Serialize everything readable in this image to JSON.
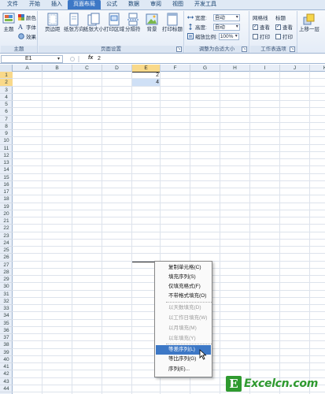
{
  "tabs": [
    "文件",
    "开始",
    "插入",
    "页面布局",
    "公式",
    "数据",
    "审阅",
    "视图",
    "开发工具"
  ],
  "active_tab": "页面布局",
  "ribbon": {
    "theme": {
      "big_label": "主题",
      "colors": "颜色",
      "fonts": "字体",
      "effects": "效果",
      "group": "主题"
    },
    "page_setup": {
      "margins": "页边距",
      "orientation": "纸张方向",
      "size": "纸张大小",
      "print_area": "打印区域",
      "breaks": "分隔符",
      "background": "背景",
      "print_titles": "打印标题",
      "group": "页面设置"
    },
    "scale": {
      "width_label": "宽度:",
      "width_value": "自动",
      "height_label": "高度:",
      "height_value": "自动",
      "scale_label": "缩放比例:",
      "scale_value": "100%",
      "group": "调整为合适大小"
    },
    "sheet_options": {
      "gridlines": "网格线",
      "headings": "标题",
      "view": "查看",
      "print": "打印",
      "group": "工作表选项"
    },
    "arrange": {
      "bring_forward": "上移一层"
    }
  },
  "formula_bar": {
    "name_box": "E1",
    "fx": "fx",
    "formula": "2"
  },
  "columns": [
    "A",
    "B",
    "C",
    "D",
    "E",
    "F",
    "G",
    "H",
    "I",
    "J",
    "K"
  ],
  "rows": [
    "1",
    "2",
    "3",
    "4",
    "5",
    "6",
    "7",
    "8",
    "9",
    "10",
    "11",
    "12",
    "13",
    "14",
    "15",
    "16",
    "17",
    "18",
    "19",
    "20",
    "21",
    "22",
    "23",
    "24",
    "25",
    "26",
    "27",
    "28",
    "29",
    "30",
    "31",
    "32",
    "33",
    "34",
    "35",
    "36",
    "37",
    "38",
    "39",
    "40",
    "41",
    "42",
    "43",
    "44"
  ],
  "cells": {
    "E1": "2",
    "E2": "4"
  },
  "context_menu": [
    {
      "label": "复制单元格(C)",
      "enabled": true
    },
    {
      "label": "填充序列(S)",
      "enabled": true
    },
    {
      "label": "仅填充格式(F)",
      "enabled": true
    },
    {
      "label": "不带格式填充(O)",
      "enabled": true
    },
    {
      "label": "以天数填充(D)",
      "enabled": false
    },
    {
      "label": "以工作日填充(W)",
      "enabled": false
    },
    {
      "label": "以月填充(M)",
      "enabled": false
    },
    {
      "label": "以年填充(Y)",
      "enabled": false
    },
    {
      "label": "等差序列(L)",
      "enabled": true,
      "highlighted": true
    },
    {
      "label": "等比序列(G)",
      "enabled": true
    },
    {
      "label": "序列(E)...",
      "enabled": true
    }
  ],
  "watermark": {
    "logo_letter": "E",
    "text": "Excelcn.com"
  },
  "colors": {
    "accent": "#3d78c6",
    "selection_header": "#f9d98a",
    "watermark": "#2f9a2f"
  }
}
